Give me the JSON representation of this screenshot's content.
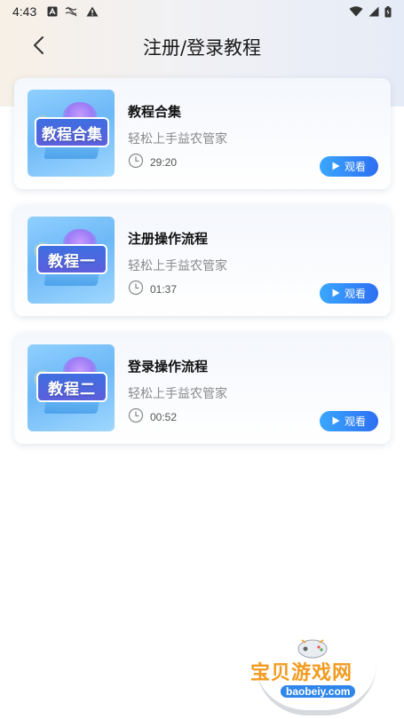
{
  "status_bar": {
    "time": "4:43",
    "left_icons": [
      "a-box-icon",
      "no-signal-icon",
      "warning-icon"
    ],
    "right_icons": [
      "wifi-icon",
      "cell-signal-icon",
      "battery-icon"
    ]
  },
  "header": {
    "back_icon": "chevron-left-icon",
    "title": "注册/登录教程"
  },
  "tutorials": [
    {
      "thumb_label": "教程合集",
      "title": "教程合集",
      "subtitle": "轻松上手益农管家",
      "duration": "29:20",
      "watch_label": "观看"
    },
    {
      "thumb_label": "教程一",
      "title": "注册操作流程",
      "subtitle": "轻松上手益农管家",
      "duration": "01:37",
      "watch_label": "观看"
    },
    {
      "thumb_label": "教程二",
      "title": "登录操作流程",
      "subtitle": "轻松上手益农管家",
      "duration": "00:52",
      "watch_label": "观看"
    }
  ],
  "watermark": {
    "text": "宝贝游戏网",
    "url": "baobeiy.com"
  },
  "colors": {
    "accent_start": "#3aa7ff",
    "accent_end": "#2d6ff2",
    "subtitle": "#8a8a8a",
    "watermark_orange": "#f29a1f"
  }
}
